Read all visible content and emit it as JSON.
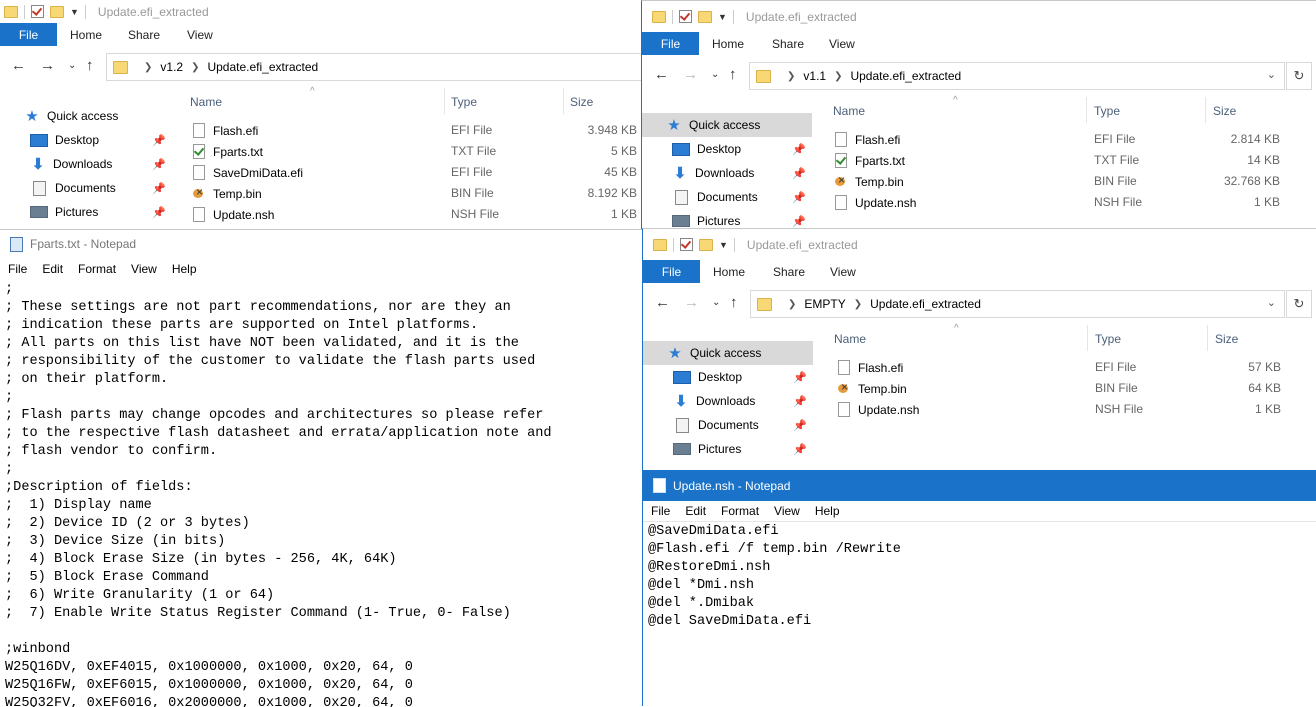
{
  "w1": {
    "title": "Update.efi_extracted",
    "tabs": [
      "File",
      "Home",
      "Share",
      "View"
    ],
    "breadcrumb": [
      "v1.2",
      "Update.efi_extracted"
    ],
    "nav": [
      "Quick access",
      "Desktop",
      "Downloads",
      "Documents",
      "Pictures"
    ],
    "cols": {
      "name": "Name",
      "type": "Type",
      "size": "Size"
    },
    "files": [
      {
        "name": "Flash.efi",
        "type": "EFI File",
        "size": "3.948 KB",
        "icon": "file-icon"
      },
      {
        "name": "Fparts.txt",
        "type": "TXT File",
        "size": "5 KB",
        "icon": "text-file-icon"
      },
      {
        "name": "SaveDmiData.efi",
        "type": "EFI File",
        "size": "45 KB",
        "icon": "file-icon"
      },
      {
        "name": "Temp.bin",
        "type": "BIN File",
        "size": "8.192 KB",
        "icon": "bin-file-icon"
      },
      {
        "name": "Update.nsh",
        "type": "NSH File",
        "size": "1 KB",
        "icon": "file-icon"
      }
    ]
  },
  "w2": {
    "title": "Update.efi_extracted",
    "tabs": [
      "File",
      "Home",
      "Share",
      "View"
    ],
    "breadcrumb": [
      "v1.1",
      "Update.efi_extracted"
    ],
    "nav": [
      "Quick access",
      "Desktop",
      "Downloads",
      "Documents",
      "Pictures"
    ],
    "cols": {
      "name": "Name",
      "type": "Type",
      "size": "Size"
    },
    "files": [
      {
        "name": "Flash.efi",
        "type": "EFI File",
        "size": "2.814 KB",
        "icon": "file-icon"
      },
      {
        "name": "Fparts.txt",
        "type": "TXT File",
        "size": "14 KB",
        "icon": "text-file-icon"
      },
      {
        "name": "Temp.bin",
        "type": "BIN File",
        "size": "32.768 KB",
        "icon": "bin-file-icon"
      },
      {
        "name": "Update.nsh",
        "type": "NSH File",
        "size": "1 KB",
        "icon": "file-icon"
      }
    ]
  },
  "w3": {
    "title": "Update.efi_extracted",
    "tabs": [
      "File",
      "Home",
      "Share",
      "View"
    ],
    "breadcrumb": [
      "EMPTY",
      "Update.efi_extracted"
    ],
    "nav": [
      "Quick access",
      "Desktop",
      "Downloads",
      "Documents",
      "Pictures"
    ],
    "cols": {
      "name": "Name",
      "type": "Type",
      "size": "Size"
    },
    "files": [
      {
        "name": "Flash.efi",
        "type": "EFI File",
        "size": "57 KB",
        "icon": "file-icon"
      },
      {
        "name": "Temp.bin",
        "type": "BIN File",
        "size": "64 KB",
        "icon": "bin-file-icon"
      },
      {
        "name": "Update.nsh",
        "type": "NSH File",
        "size": "1 KB",
        "icon": "file-icon"
      }
    ]
  },
  "np1": {
    "title": "Fparts.txt - Notepad",
    "menu": [
      "File",
      "Edit",
      "Format",
      "View",
      "Help"
    ],
    "text": ";\n; These settings are not part recommendations, nor are they an\n; indication these parts are supported on Intel platforms.\n; All parts on this list have NOT been validated, and it is the\n; responsibility of the customer to validate the flash parts used\n; on their platform.\n;\n; Flash parts may change opcodes and architectures so please refer\n; to the respective flash datasheet and errata/application note and\n; flash vendor to confirm.\n;\n;Description of fields:\n;  1) Display name\n;  2) Device ID (2 or 3 bytes)\n;  3) Device Size (in bits)\n;  4) Block Erase Size (in bytes - 256, 4K, 64K)\n;  5) Block Erase Command\n;  6) Write Granularity (1 or 64)\n;  7) Enable Write Status Register Command (1- True, 0- False)\n\n;winbond\nW25Q16DV, 0xEF4015, 0x1000000, 0x1000, 0x20, 64, 0\nW25Q16FW, 0xEF6015, 0x1000000, 0x1000, 0x20, 64, 0\nW25Q32FV, 0xEF6016, 0x2000000, 0x1000, 0x20, 64, 0"
  },
  "np2": {
    "title": "Update.nsh - Notepad",
    "menu": [
      "File",
      "Edit",
      "Format",
      "View",
      "Help"
    ],
    "text": "@SaveDmiData.efi\n@Flash.efi /f temp.bin /Rewrite\n@RestoreDmi.nsh\n@del *Dmi.nsh\n@del *.Dmibak\n@del SaveDmiData.efi"
  },
  "colors": {
    "accent": "#1a73c8",
    "selection": "#d9d9d9",
    "header_text": "#4c607a"
  }
}
